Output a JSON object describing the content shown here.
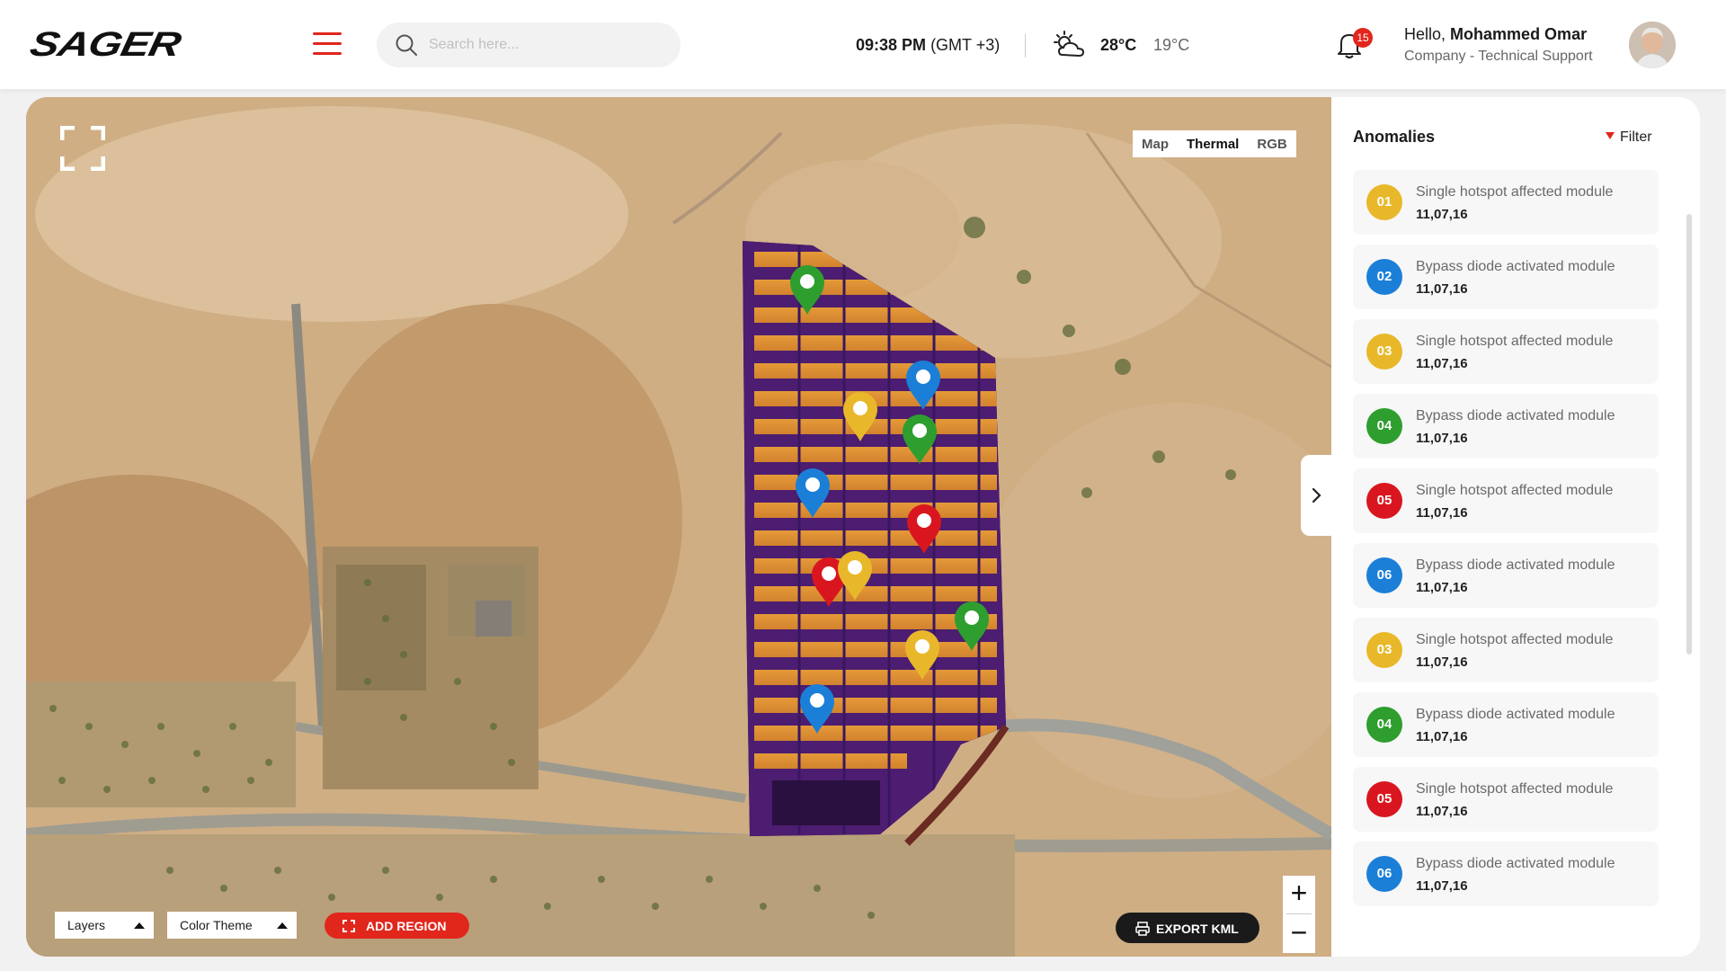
{
  "header": {
    "logo_text": "SAGER",
    "search_placeholder": "Search here...",
    "time_value": "09:38 PM",
    "time_zone": "(GMT +3)",
    "temp_high": "28°C",
    "temp_low": "19°C",
    "notifications_count": "15",
    "greeting": "Hello,",
    "user_name": "Mohammed Omar",
    "user_role": "Company - Technical Support"
  },
  "map": {
    "views": [
      "Map",
      "Thermal",
      "RGB"
    ],
    "active_view": "Thermal",
    "layers_label": "Layers",
    "color_theme_label": "Color Theme",
    "add_region_label": "ADD REGION",
    "export_label": "EXPORT KML",
    "zoom_in": "+",
    "zoom_out": "−",
    "pins": [
      {
        "status": "green"
      },
      {
        "status": "blue"
      },
      {
        "status": "yellow"
      },
      {
        "status": "green"
      },
      {
        "status": "blue"
      },
      {
        "status": "red"
      },
      {
        "status": "red"
      },
      {
        "status": "yellow"
      },
      {
        "status": "green"
      },
      {
        "status": "yellow"
      },
      {
        "status": "blue"
      }
    ]
  },
  "colors": {
    "accent": "#e1261c",
    "yellow": "#e8b82a",
    "blue": "#1b7fd8",
    "green": "#2e9e2f",
    "red": "#d9161f"
  },
  "anomalies": {
    "title": "Anomalies",
    "filter_label": "Filter",
    "items": [
      {
        "num": "01",
        "title": "Single hotspot affected module",
        "code": "11,07,16",
        "color": "#e8b82a"
      },
      {
        "num": "02",
        "title": "Bypass diode activated module",
        "code": "11,07,16",
        "color": "#1b7fd8"
      },
      {
        "num": "03",
        "title": "Single hotspot affected module",
        "code": "11,07,16",
        "color": "#e8b82a"
      },
      {
        "num": "04",
        "title": "Bypass diode activated module",
        "code": "11,07,16",
        "color": "#2e9e2f"
      },
      {
        "num": "05",
        "title": "Single hotspot affected module",
        "code": "11,07,16",
        "color": "#d9161f"
      },
      {
        "num": "06",
        "title": "Bypass diode activated module",
        "code": "11,07,16",
        "color": "#1b7fd8"
      },
      {
        "num": "03",
        "title": "Single hotspot affected module",
        "code": "11,07,16",
        "color": "#e8b82a"
      },
      {
        "num": "04",
        "title": "Bypass diode activated module",
        "code": "11,07,16",
        "color": "#2e9e2f"
      },
      {
        "num": "05",
        "title": "Single hotspot affected module",
        "code": "11,07,16",
        "color": "#d9161f"
      },
      {
        "num": "06",
        "title": "Bypass diode activated module",
        "code": "11,07,16",
        "color": "#1b7fd8"
      }
    ]
  }
}
